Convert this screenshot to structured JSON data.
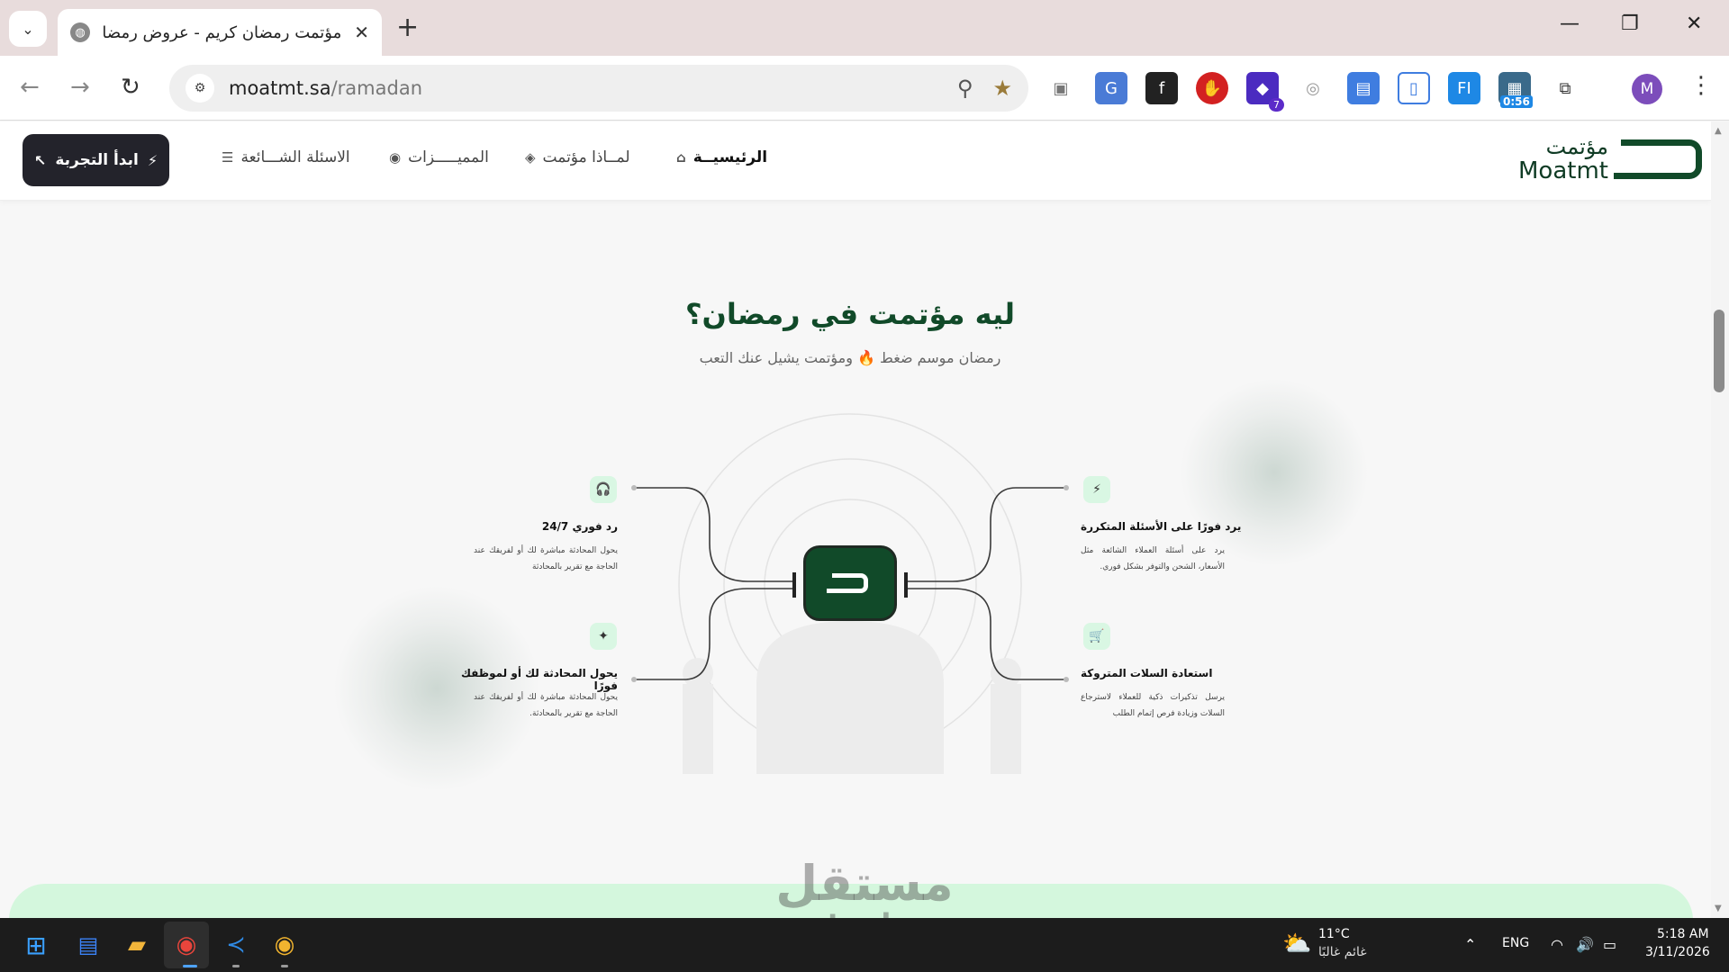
{
  "browser": {
    "tab_title": "مؤتمت رمضان كريم - عروض رمضان",
    "new_tab": "+",
    "url_host": "moatmt.sa",
    "url_path": "/ramadan",
    "ext_badge_count": "7",
    "ext_timer": "0:56",
    "profile_initial": "M"
  },
  "header": {
    "cta_label": "ابدأ التجربة",
    "nav": [
      {
        "label": "الرئيسيــة"
      },
      {
        "label": "لمــاذا مؤتمت"
      },
      {
        "label": "المميـــــزات"
      },
      {
        "label": "الاسئلة الشـــائعة"
      }
    ],
    "logo_ar": "مؤتمت",
    "logo_en": "Moatmt"
  },
  "section": {
    "title": "ليه مؤتمت في رمضان؟",
    "subtitle_a": "رمضان موسم ضغط",
    "subtitle_b": "ومؤتمت يشيل عنك التعب"
  },
  "features": [
    {
      "title": "يرد فورًا على الأسئلة المتكررة",
      "desc": "يرد على أسئلة العملاء الشائعة مثل الأسعار، الشحن والتوفر بشكل فوري.",
      "icon": "lightning-icon"
    },
    {
      "title": "استعادة السلات المتروكة",
      "desc": "يرسل تذكيرات ذكية للعملاء لاسترجاع السلات وزيادة فرص إتمام الطلب",
      "icon": "cart-icon"
    },
    {
      "title": "رد فوري 24/7",
      "desc": "يحول المحادثة مباشرة لك أو لفريقك عند الحاجة مع تقرير بالمحادثة",
      "icon": "headset-icon"
    },
    {
      "title": "يحول المحادثة لك أو لموظفك فورًا",
      "desc": "يحول المحادثة مباشرة لك أو لفريقك عند الحاجة مع تقرير بالمحادثة.",
      "icon": "sparkle-icon"
    }
  ],
  "watermark": {
    "ar": "مستقل",
    "en": "mostaql.com"
  },
  "taskbar": {
    "weather_temp": "11°C",
    "weather_desc": "غائم غالبًا",
    "lang": "ENG",
    "time": "5:18 AM",
    "date": "3/11/2026"
  }
}
